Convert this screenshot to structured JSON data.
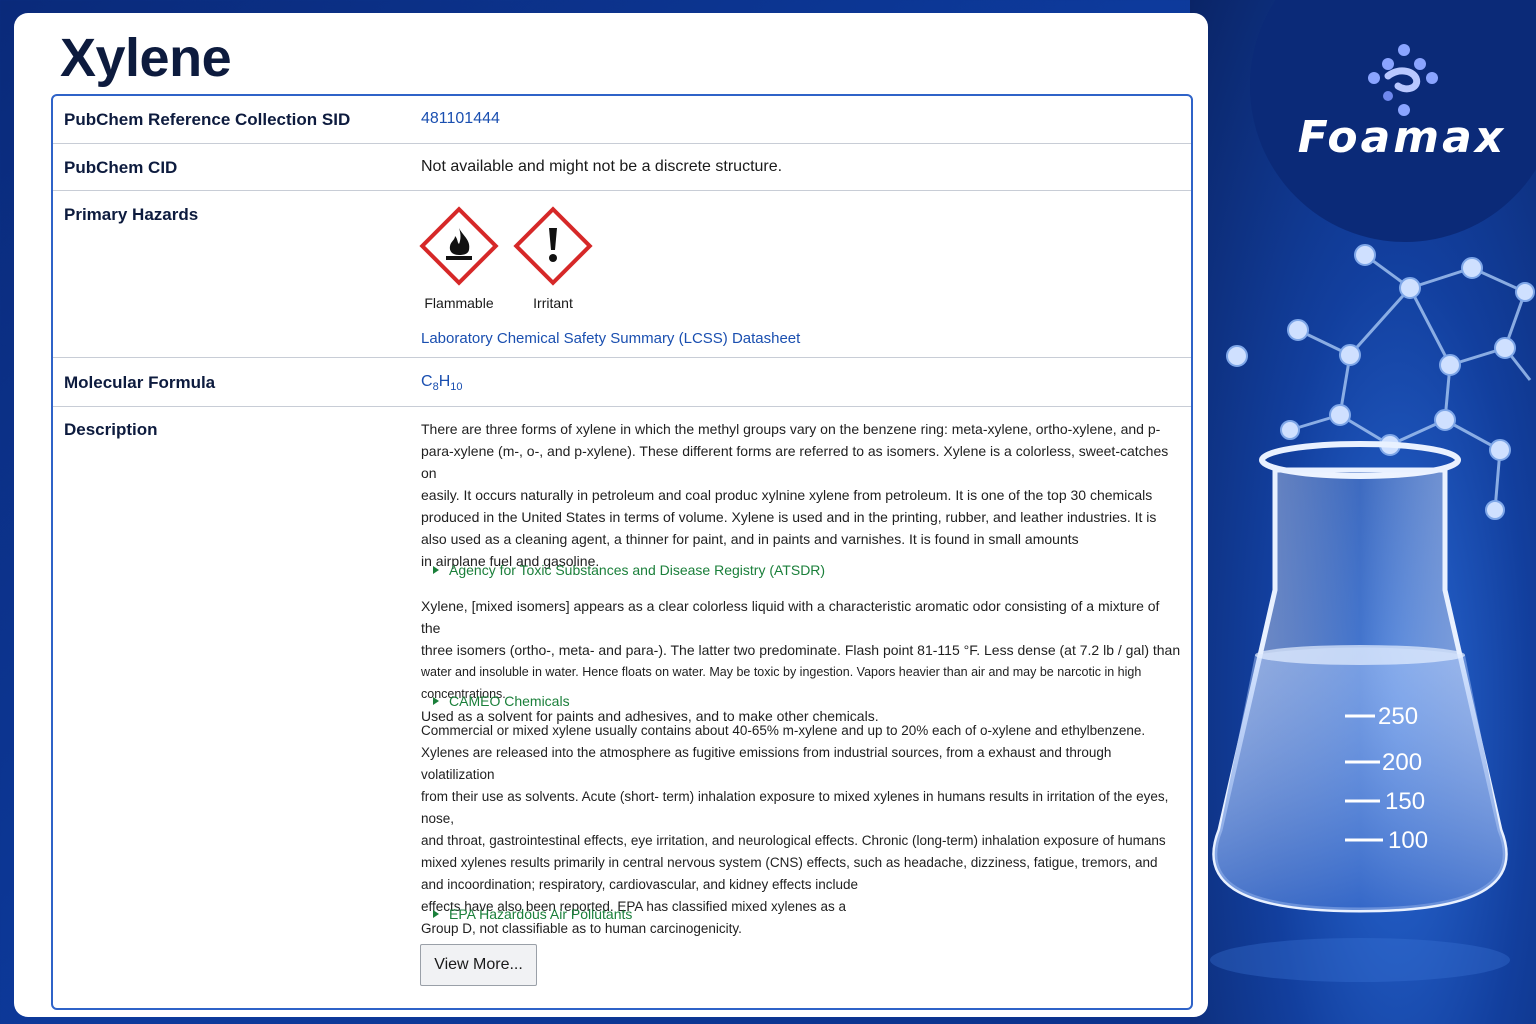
{
  "title": "Xylene",
  "brand": {
    "name": "Foamax"
  },
  "flask_marks": [
    "250",
    "200",
    "150",
    "100"
  ],
  "colors": {
    "accent": "#2f63c8",
    "link": "#1a4fb0",
    "source": "#1a7f3a",
    "title": "#0d1b3e",
    "hazard_red": "#d62828"
  },
  "rows": {
    "sid": {
      "label": "PubChem Reference Collection SID",
      "value": "481101444"
    },
    "cid": {
      "label": "PubChem CID",
      "value": "Not available and might not be a discrete structure."
    },
    "hazards": {
      "label": "Primary Hazards",
      "pictograms": [
        {
          "icon": "flame-pictogram-icon",
          "label": "Flammable"
        },
        {
          "icon": "exclamation-pictogram-icon",
          "label": "Irritant"
        }
      ],
      "lcss_link": "Laboratory Chemical Safety Summary (LCSS) Datasheet"
    },
    "formula": {
      "label": "Molecular Formula",
      "c": "C",
      "c_sub": "8",
      "h": "H",
      "h_sub": "10"
    },
    "description": {
      "label": "Description",
      "blocks": [
        {
          "lines": [
            "There are three forms of xylene in which the methyl groups vary on the benzene ring: meta-xylene, ortho-xylene, and p-",
            "para-xylene (m-, o-, and p-xylene). These different forms are referred to as isomers. Xylene is a colorless, sweet-catches on",
            "easily. It occurs naturally in petroleum and coal produc xylnine xylene from petroleum. It is one of the top 30 chemicals",
            "produced in the United States in terms of volume. Xylene is used and in the printing, rubber, and leather industries. It is",
            "also used as a cleaning agent, a thinner for paint, and in paints and varnishes. It is found in small amounts",
            "in airplane fuel and gasoline."
          ],
          "source": "Agency for Toxic Substances and Disease Registry (ATSDR)"
        },
        {
          "lines": [
            "Xylene, [mixed isomers] appears as a clear colorless liquid with a characteristic aromatic odor consisting of a mixture of the",
            "three isomers (ortho-, meta- and para-). The latter two predominate. Flash point 81-115 °F. Less dense (at 7.2 lb / gal) than",
            "water and insoluble in water. Hence floats on water. May be toxic by ingestion. Vapors heavier than air and may be narcotic in high concentrations.",
            "Used as a solvent for paints and adhesives, and to make other chemicals."
          ],
          "source": "CAMEO Chemicals"
        },
        {
          "lines": [
            "Commercial or mixed xylene usually contains about 40-65% m-xylene and up to 20% each of o-xylene and ethylbenzene.",
            "Xylenes are released into the atmosphere as fugitive emissions from industrial sources, from a exhaust and through volatilization",
            "from their use as solvents. Acute (short- term) inhalation exposure to mixed xylenes in humans results in irritation of the eyes, nose,",
            "and throat, gastrointestinal effects, eye irritation, and neurological effects. Chronic (long-term) inhalation exposure of humans",
            "mixed xylenes results primarily in central nervous system (CNS) effects, such as headache, dizziness, fatigue, tremors, and",
            "and incoordination; respiratory, cardiovascular, and kidney effects include",
            "effects have also been reported. EPA has classified mixed xylenes as a",
            "Group D, not classifiable as to human carcinogenicity."
          ],
          "source": "EPA Hazardous Air Pollutants"
        }
      ],
      "view_more": "View More..."
    }
  }
}
